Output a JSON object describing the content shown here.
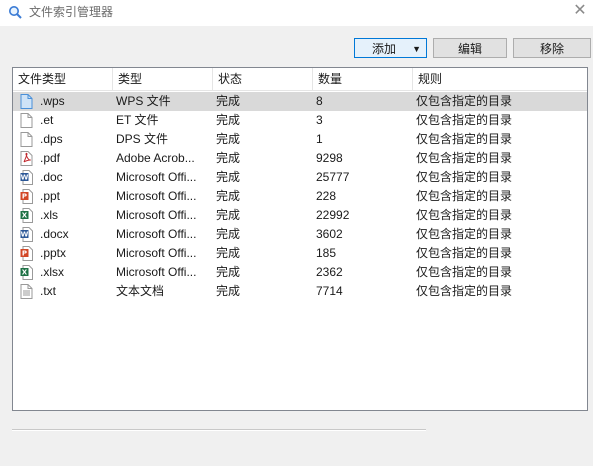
{
  "window": {
    "title": "文件索引管理器",
    "close_glyph": "✕"
  },
  "toolbar": {
    "add_label": "添加",
    "add_arrow": "▼",
    "edit_label": "编辑",
    "remove_label": "移除"
  },
  "table": {
    "columns": [
      "文件类型",
      "类型",
      "状态",
      "数量",
      "规则"
    ],
    "rows": [
      {
        "ext": ".wps",
        "type": "WPS 文件",
        "status": "完成",
        "count": "8",
        "rule": "仅包含指定的目录",
        "icon": "doc-blue-icon",
        "selected": true
      },
      {
        "ext": ".et",
        "type": "ET 文件",
        "status": "完成",
        "count": "3",
        "rule": "仅包含指定的目录",
        "icon": "file-blank-icon"
      },
      {
        "ext": ".dps",
        "type": "DPS 文件",
        "status": "完成",
        "count": "1",
        "rule": "仅包含指定的目录",
        "icon": "file-blank-icon"
      },
      {
        "ext": ".pdf",
        "type": "Adobe Acrob...",
        "status": "完成",
        "count": "9298",
        "rule": "仅包含指定的目录",
        "icon": "pdf-icon"
      },
      {
        "ext": ".doc",
        "type": "Microsoft Offi...",
        "status": "完成",
        "count": "25777",
        "rule": "仅包含指定的目录",
        "icon": "word-icon"
      },
      {
        "ext": ".ppt",
        "type": "Microsoft Offi...",
        "status": "完成",
        "count": "228",
        "rule": "仅包含指定的目录",
        "icon": "powerpoint-icon"
      },
      {
        "ext": ".xls",
        "type": "Microsoft Offi...",
        "status": "完成",
        "count": "22992",
        "rule": "仅包含指定的目录",
        "icon": "excel-icon"
      },
      {
        "ext": ".docx",
        "type": "Microsoft Offi...",
        "status": "完成",
        "count": "3602",
        "rule": "仅包含指定的目录",
        "icon": "word-icon"
      },
      {
        "ext": ".pptx",
        "type": "Microsoft Offi...",
        "status": "完成",
        "count": "185",
        "rule": "仅包含指定的目录",
        "icon": "powerpoint-icon"
      },
      {
        "ext": ".xlsx",
        "type": "Microsoft Offi...",
        "status": "完成",
        "count": "2362",
        "rule": "仅包含指定的目录",
        "icon": "excel-icon"
      },
      {
        "ext": ".txt",
        "type": "文本文档",
        "status": "完成",
        "count": "7714",
        "rule": "仅包含指定的目录",
        "icon": "text-file-icon"
      }
    ]
  },
  "colors": {
    "selected_row": "#d9d9d9",
    "word": "#2b5797",
    "excel": "#1e7145",
    "powerpoint": "#d24726",
    "pdf": "#c1272d",
    "wps": "#4a90d9"
  }
}
